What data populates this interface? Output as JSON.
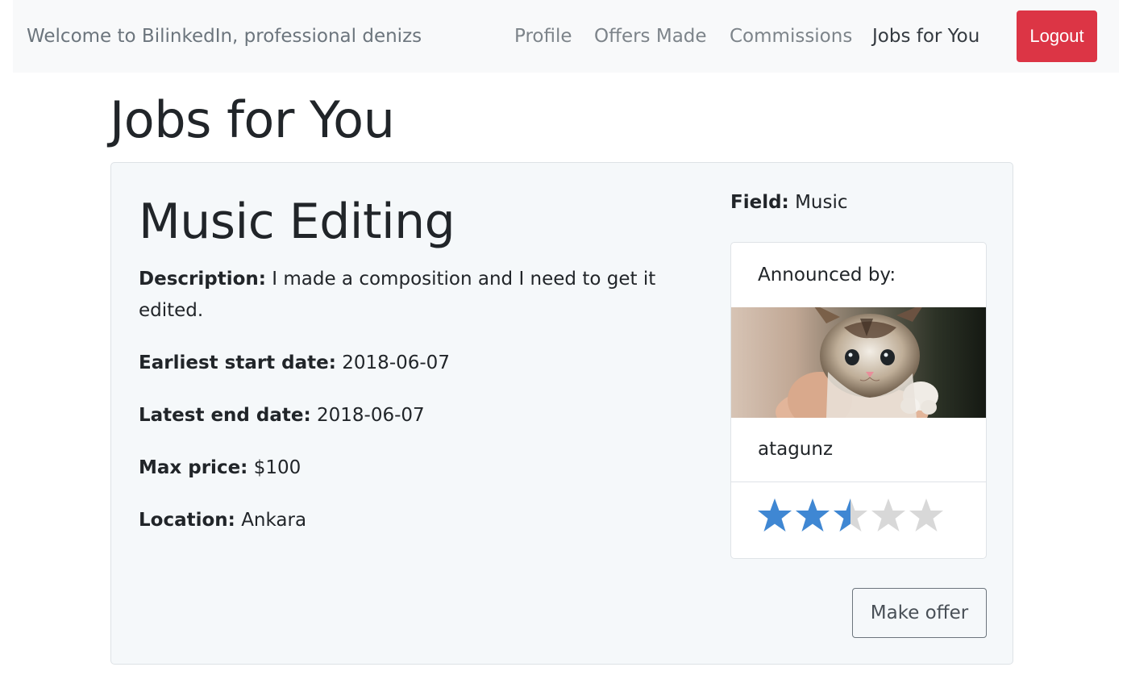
{
  "nav": {
    "brand": "Welcome to BilinkedIn, professional denizs",
    "links": [
      "Profile",
      "Offers Made",
      "Commissions",
      "Jobs for You"
    ],
    "logout": "Logout"
  },
  "page": {
    "title": "Jobs for You"
  },
  "job": {
    "title": "Music Editing",
    "description_label": "Description:",
    "description": "I made a composition and I need to get it edited.",
    "start_label": "Earliest start date:",
    "start": "2018-06-07",
    "end_label": "Latest end date:",
    "end": "2018-06-07",
    "price_label": "Max price:",
    "price": "$100",
    "location_label": "Location:",
    "location": "Ankara",
    "field_label": "Field:",
    "field": "Music",
    "make_offer": "Make offer"
  },
  "announcer": {
    "label": "Announced by:",
    "username": "atagunz",
    "photo_icon": "kitten-photo",
    "rating": 2.5,
    "rating_max": 5,
    "star_color": "#3f87d3",
    "star_empty_color": "#d8d8d8"
  }
}
